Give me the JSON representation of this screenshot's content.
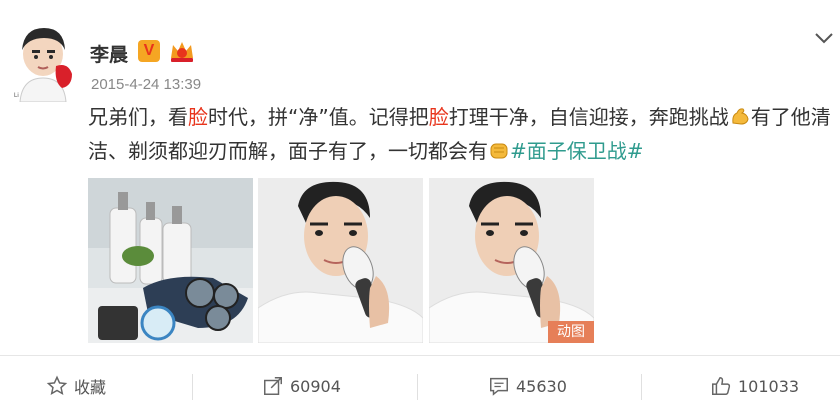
{
  "post": {
    "username": "李晨",
    "verified_badge": "V",
    "timestamp": "2015-4-24 13:39",
    "text": {
      "part1": "兄弟们，看",
      "highlight1": "脸",
      "part2": "时代，拼“净”值。记得把",
      "highlight2": "脸",
      "part3": "打理干净，自信迎接，奔跑挑战",
      "part4": "有了他清洁、剃须都迎刃而解，面子有了，一切都会有",
      "hashtag": "#面子保卫战#"
    },
    "gif_label": "动图",
    "icons": {
      "avatar": "cartoon-avatar",
      "badge": "verified-v-icon",
      "crown": "crown-icon",
      "flex": "flexed-biceps-emoji",
      "fist": "fist-emoji",
      "menu": "chevron-down-icon"
    },
    "colors": {
      "highlight": "#e8341c",
      "hashtag": "#2f9b8e",
      "badge": "#f5a623",
      "gif_badge": "#e67f58"
    }
  },
  "actions": {
    "favorite_label": "收藏",
    "repost_count": "60904",
    "comment_count": "45630",
    "like_count": "101033"
  }
}
